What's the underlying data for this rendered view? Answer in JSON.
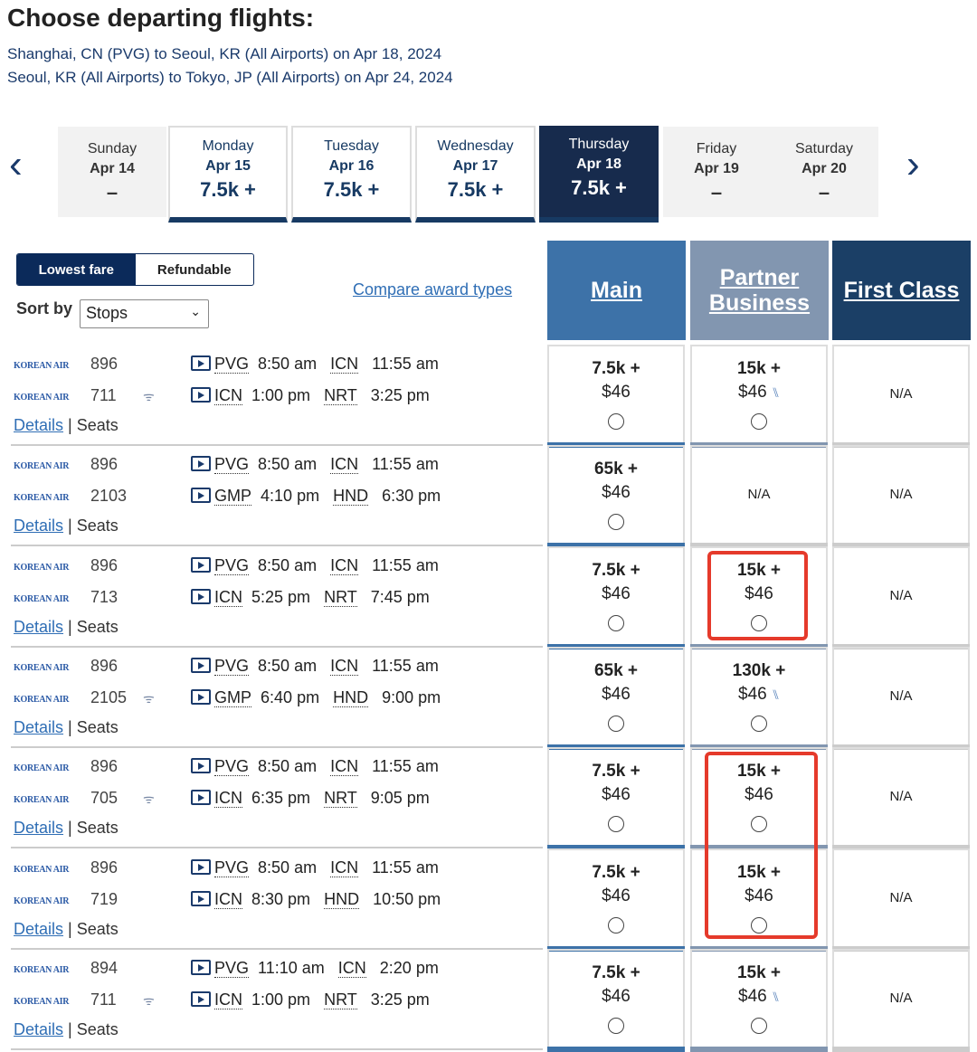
{
  "title": "Choose departing flights:",
  "routes": [
    "Shanghai, CN (PVG) to Seoul, KR (All Airports) on Apr 18, 2024",
    "Seoul, KR (All Airports) to Tokyo, JP (All Airports) on Apr 24, 2024"
  ],
  "dates": [
    {
      "day": "Sunday",
      "date": "Apr 14",
      "price": "–",
      "state": "none"
    },
    {
      "day": "Monday",
      "date": "Apr 15",
      "price": "7.5k +",
      "state": "avail"
    },
    {
      "day": "Tuesday",
      "date": "Apr 16",
      "price": "7.5k +",
      "state": "avail"
    },
    {
      "day": "Wednesday",
      "date": "Apr 17",
      "price": "7.5k +",
      "state": "avail"
    },
    {
      "day": "Thursday",
      "date": "Apr 18",
      "price": "7.5k +",
      "state": "selected"
    },
    {
      "day": "Friday",
      "date": "Apr 19",
      "price": "–",
      "state": "none"
    },
    {
      "day": "Saturday",
      "date": "Apr 20",
      "price": "–",
      "state": "none"
    }
  ],
  "nav": {
    "prev": "‹",
    "next": "›"
  },
  "toggle": {
    "lowest": "Lowest fare",
    "refundable": "Refundable"
  },
  "sort": {
    "label": "Sort by",
    "value": "Stops"
  },
  "compare": "Compare award types",
  "columns": [
    {
      "label": "Main",
      "color": "#3d72a8"
    },
    {
      "label": "Partner Business",
      "color": "#8296b0"
    },
    {
      "label": "First Class",
      "color": "#1b3f66"
    }
  ],
  "airline": "KOREAN AIR",
  "links": {
    "details": "Details",
    "seats": "Seats"
  },
  "flights": [
    {
      "legs": [
        {
          "no": "896",
          "wifi": false,
          "from": "PVG",
          "dep": "8:50 am",
          "to": "ICN",
          "arr": "11:55 am"
        },
        {
          "no": "711",
          "wifi": true,
          "from": "ICN",
          "dep": "1:00 pm",
          "to": "NRT",
          "arr": "3:25 pm"
        }
      ],
      "fares": [
        {
          "pts": "7.5k +",
          "fee": "$46"
        },
        {
          "pts": "15k +",
          "fee": "$46",
          "seat": true
        },
        {
          "na": "N/A"
        }
      ]
    },
    {
      "legs": [
        {
          "no": "896",
          "wifi": false,
          "from": "PVG",
          "dep": "8:50 am",
          "to": "ICN",
          "arr": "11:55 am"
        },
        {
          "no": "2103",
          "wifi": false,
          "from": "GMP",
          "dep": "4:10 pm",
          "to": "HND",
          "arr": "6:30 pm"
        }
      ],
      "fares": [
        {
          "pts": "65k +",
          "fee": "$46"
        },
        {
          "na": "N/A"
        },
        {
          "na": "N/A"
        }
      ]
    },
    {
      "legs": [
        {
          "no": "896",
          "wifi": false,
          "from": "PVG",
          "dep": "8:50 am",
          "to": "ICN",
          "arr": "11:55 am"
        },
        {
          "no": "713",
          "wifi": false,
          "from": "ICN",
          "dep": "5:25 pm",
          "to": "NRT",
          "arr": "7:45 pm"
        }
      ],
      "fares": [
        {
          "pts": "7.5k +",
          "fee": "$46"
        },
        {
          "pts": "15k +",
          "fee": "$46"
        },
        {
          "na": "N/A"
        }
      ]
    },
    {
      "legs": [
        {
          "no": "896",
          "wifi": false,
          "from": "PVG",
          "dep": "8:50 am",
          "to": "ICN",
          "arr": "11:55 am"
        },
        {
          "no": "2105",
          "wifi": true,
          "from": "GMP",
          "dep": "6:40 pm",
          "to": "HND",
          "arr": "9:00 pm"
        }
      ],
      "fares": [
        {
          "pts": "65k +",
          "fee": "$46"
        },
        {
          "pts": "130k +",
          "fee": "$46",
          "seat": true
        },
        {
          "na": "N/A"
        }
      ]
    },
    {
      "legs": [
        {
          "no": "896",
          "wifi": false,
          "from": "PVG",
          "dep": "8:50 am",
          "to": "ICN",
          "arr": "11:55 am"
        },
        {
          "no": "705",
          "wifi": true,
          "from": "ICN",
          "dep": "6:35 pm",
          "to": "NRT",
          "arr": "9:05 pm"
        }
      ],
      "fares": [
        {
          "pts": "7.5k +",
          "fee": "$46"
        },
        {
          "pts": "15k +",
          "fee": "$46"
        },
        {
          "na": "N/A"
        }
      ]
    },
    {
      "legs": [
        {
          "no": "896",
          "wifi": false,
          "from": "PVG",
          "dep": "8:50 am",
          "to": "ICN",
          "arr": "11:55 am"
        },
        {
          "no": "719",
          "wifi": false,
          "from": "ICN",
          "dep": "8:30 pm",
          "to": "HND",
          "arr": "10:50 pm"
        }
      ],
      "fares": [
        {
          "pts": "7.5k +",
          "fee": "$46"
        },
        {
          "pts": "15k +",
          "fee": "$46"
        },
        {
          "na": "N/A"
        }
      ]
    },
    {
      "legs": [
        {
          "no": "894",
          "wifi": false,
          "from": "PVG",
          "dep": "11:10 am",
          "to": "ICN",
          "arr": "2:20 pm"
        },
        {
          "no": "711",
          "wifi": true,
          "from": "ICN",
          "dep": "1:00 pm",
          "to": "NRT",
          "arr": "3:25 pm"
        }
      ],
      "fares": [
        {
          "pts": "7.5k +",
          "fee": "$46"
        },
        {
          "pts": "15k +",
          "fee": "$46",
          "seat": true
        },
        {
          "na": "N/A"
        }
      ]
    }
  ],
  "highlight_color": "#e53a2b"
}
